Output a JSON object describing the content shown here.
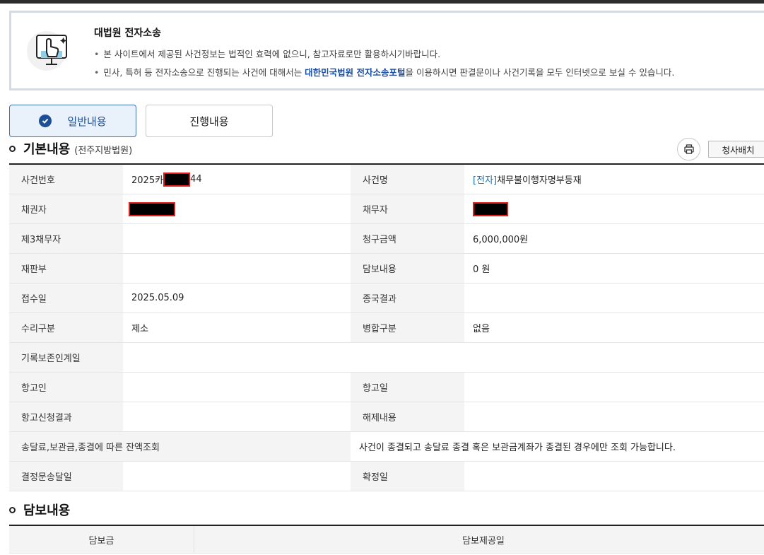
{
  "notice": {
    "title": "대법원 전자소송",
    "line1": "본 사이트에서 제공된 사건정보는 법적인 효력에 없으니, 참고자료로만 활용하시기바랍니다.",
    "line2_before": "민사, 특허 등 전자소송으로 진행되는 사건에 대해서는 ",
    "line2_link": "대한민국법원 전자소송포털",
    "line2_after": "을 이용하시면 판결문이나 사건기록을 모두 인터넷으로 보실 수 있습니다."
  },
  "tabs": {
    "general": "일반내용",
    "progress": "진행내용"
  },
  "basic_section": {
    "title": "기본내용",
    "court": "(전주지방법원)",
    "print_icon": "print-icon",
    "action_button": "청사배치"
  },
  "fields": {
    "case_number_label": "사건번호",
    "case_number_prefix": "2025카",
    "case_number_suffix": "44",
    "case_name_label": "사건명",
    "case_name_prefix": "[전자]",
    "case_name": "채무불이행자명부등재",
    "creditor_label": "채권자",
    "debtor_label": "채무자",
    "third_debtor_label": "제3채무자",
    "claim_amount_label": "청구금액",
    "claim_amount": "6,000,000원",
    "court_division_label": "재판부",
    "security_label": "담보내용",
    "security_value": "0 원",
    "receipt_date_label": "접수일",
    "receipt_date": "2025.05.09",
    "final_result_label": "종국결과",
    "acceptance_label": "수리구분",
    "acceptance_value": "제소",
    "merge_label": "병합구분",
    "merge_value": "없음",
    "record_preservation_label": "기록보존인계일",
    "appellant_label": "항고인",
    "appeal_date_label": "항고일",
    "appeal_result_label": "항고신청결과",
    "release_label": "해제내용",
    "balance_label": "송달료,보관금,종결에 따른 잔액조회",
    "balance_value": "사건이 종결되고 송달료 종결 혹은 보관금계좌가 종결된 경우에만 조회 가능합니다.",
    "decision_delivery_label": "결정문송달일",
    "confirmation_date_label": "확정일"
  },
  "guarantee_section": {
    "title": "담보내용",
    "col1": "담보금",
    "col2": "담보제공일"
  }
}
